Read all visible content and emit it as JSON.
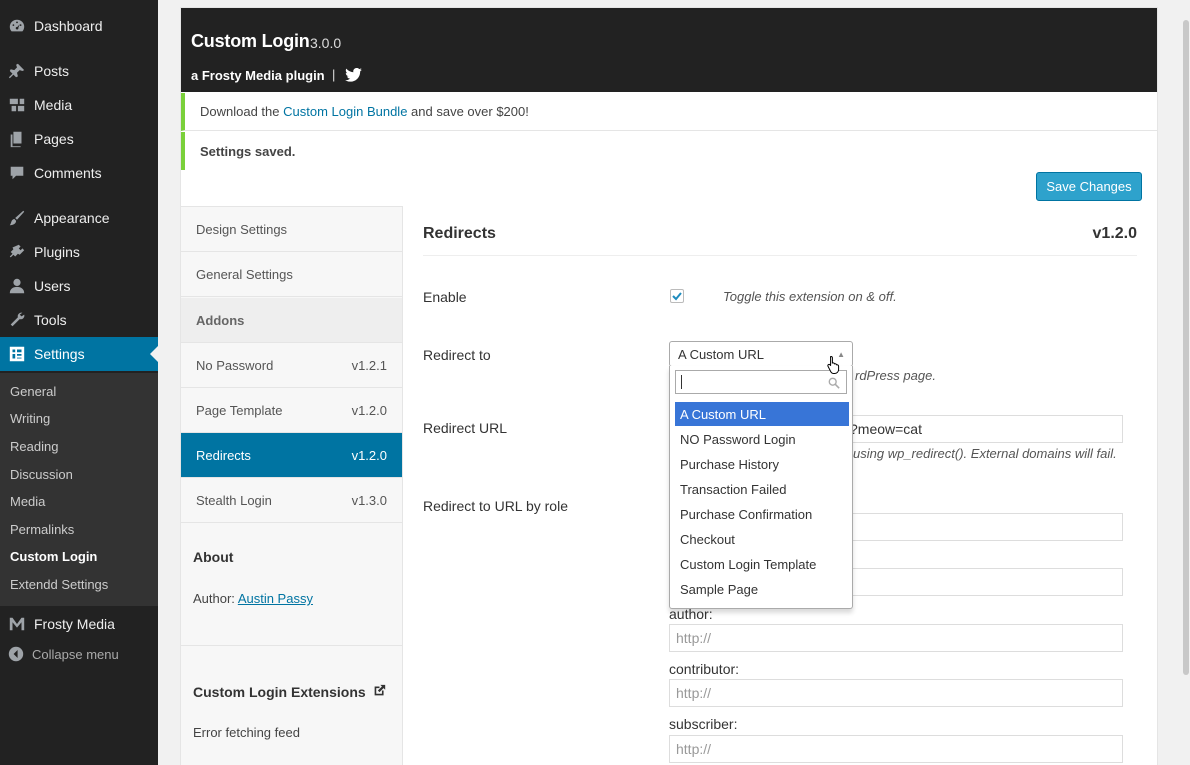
{
  "menu": {
    "items": [
      {
        "label": "Dashboard",
        "icon": "dashboard-icon"
      },
      {
        "label": "Posts",
        "icon": "pin-icon"
      },
      {
        "label": "Media",
        "icon": "media-icon"
      },
      {
        "label": "Pages",
        "icon": "pages-icon"
      },
      {
        "label": "Comments",
        "icon": "comment-icon"
      },
      {
        "label": "Appearance",
        "icon": "brush-icon"
      },
      {
        "label": "Plugins",
        "icon": "plug-icon"
      },
      {
        "label": "Users",
        "icon": "user-icon"
      },
      {
        "label": "Tools",
        "icon": "wrench-icon"
      },
      {
        "label": "Settings",
        "icon": "settings-icon"
      }
    ],
    "submenu": [
      "General",
      "Writing",
      "Reading",
      "Discussion",
      "Media",
      "Permalinks",
      "Custom Login",
      "Extendd Settings"
    ],
    "frosty": "Frosty Media",
    "collapse": "Collapse menu"
  },
  "header": {
    "title": "Custom Login",
    "version": "3.0.0",
    "tagline": "a Frosty Media plugin",
    "separator": "|"
  },
  "notices": {
    "promo_prefix": "Download the ",
    "promo_link": "Custom Login Bundle",
    "promo_suffix": " and save over $200!",
    "saved": "Settings saved."
  },
  "save_label": "Save Changes",
  "nav": {
    "design": "Design Settings",
    "general": "General Settings",
    "addons": "Addons",
    "addon_items": [
      {
        "name": "No Password",
        "version": "v1.2.1"
      },
      {
        "name": "Page Template",
        "version": "v1.2.0"
      },
      {
        "name": "Redirects",
        "version": "v1.2.0"
      },
      {
        "name": "Stealth Login",
        "version": "v1.3.0"
      }
    ],
    "about_title": "About",
    "author_label": "Author: ",
    "author_name": "Austin Passy",
    "ext_title": "Custom Login Extensions",
    "ext_error": "Error fetching feed"
  },
  "section": {
    "title": "Redirects",
    "version": "v1.2.0",
    "enable_label": "Enable",
    "enable_desc": "Toggle this extension on & off.",
    "enable_checked": true,
    "redirect_to_label": "Redirect to",
    "redirect_to_value": "A Custom URL",
    "redirect_to_desc_visible": "rdPress page.",
    "redirect_url_label": "Redirect URL",
    "redirect_url_visible": "?meow=cat",
    "redirect_url_desc_visible": "using wp_redirect(). External domains will fail.",
    "by_role_label": "Redirect to URL by role",
    "roles": [
      {
        "label": "author:",
        "placeholder": "http://"
      },
      {
        "label": "contributor:",
        "placeholder": "http://"
      },
      {
        "label": "subscriber:",
        "placeholder": "http://"
      }
    ]
  },
  "dropdown": {
    "search_value": "",
    "options": [
      "A Custom URL",
      "NO Password Login",
      "Purchase History",
      "Transaction Failed",
      "Purchase Confirmation",
      "Checkout",
      "Custom Login Template",
      "Sample Page"
    ],
    "highlighted": "A Custom URL"
  },
  "colors": {
    "admin_bg": "#222222",
    "accent": "#0074a2",
    "button": "#2ea2cc",
    "notice_border": "#7ad03a",
    "highlight": "#3875d7"
  }
}
